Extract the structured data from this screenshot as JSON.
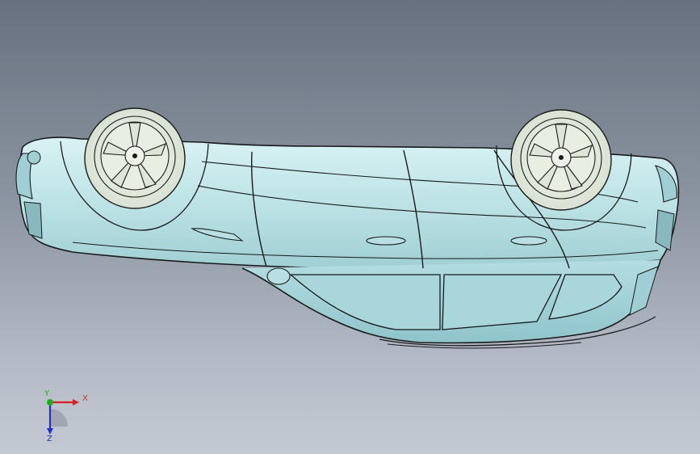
{
  "viewport": {
    "background_top": "#68717f",
    "background_bottom": "#c4cad3"
  },
  "model": {
    "body_color": "#c7e8ea",
    "edge_color": "#1a1a1a",
    "wheel_color": "#e8efe2"
  },
  "triad": {
    "x_label": "X",
    "y_label": "Y",
    "z_label": "Z",
    "x_color": "#d42020",
    "y_color": "#1bb01b",
    "z_color": "#2330c8"
  }
}
